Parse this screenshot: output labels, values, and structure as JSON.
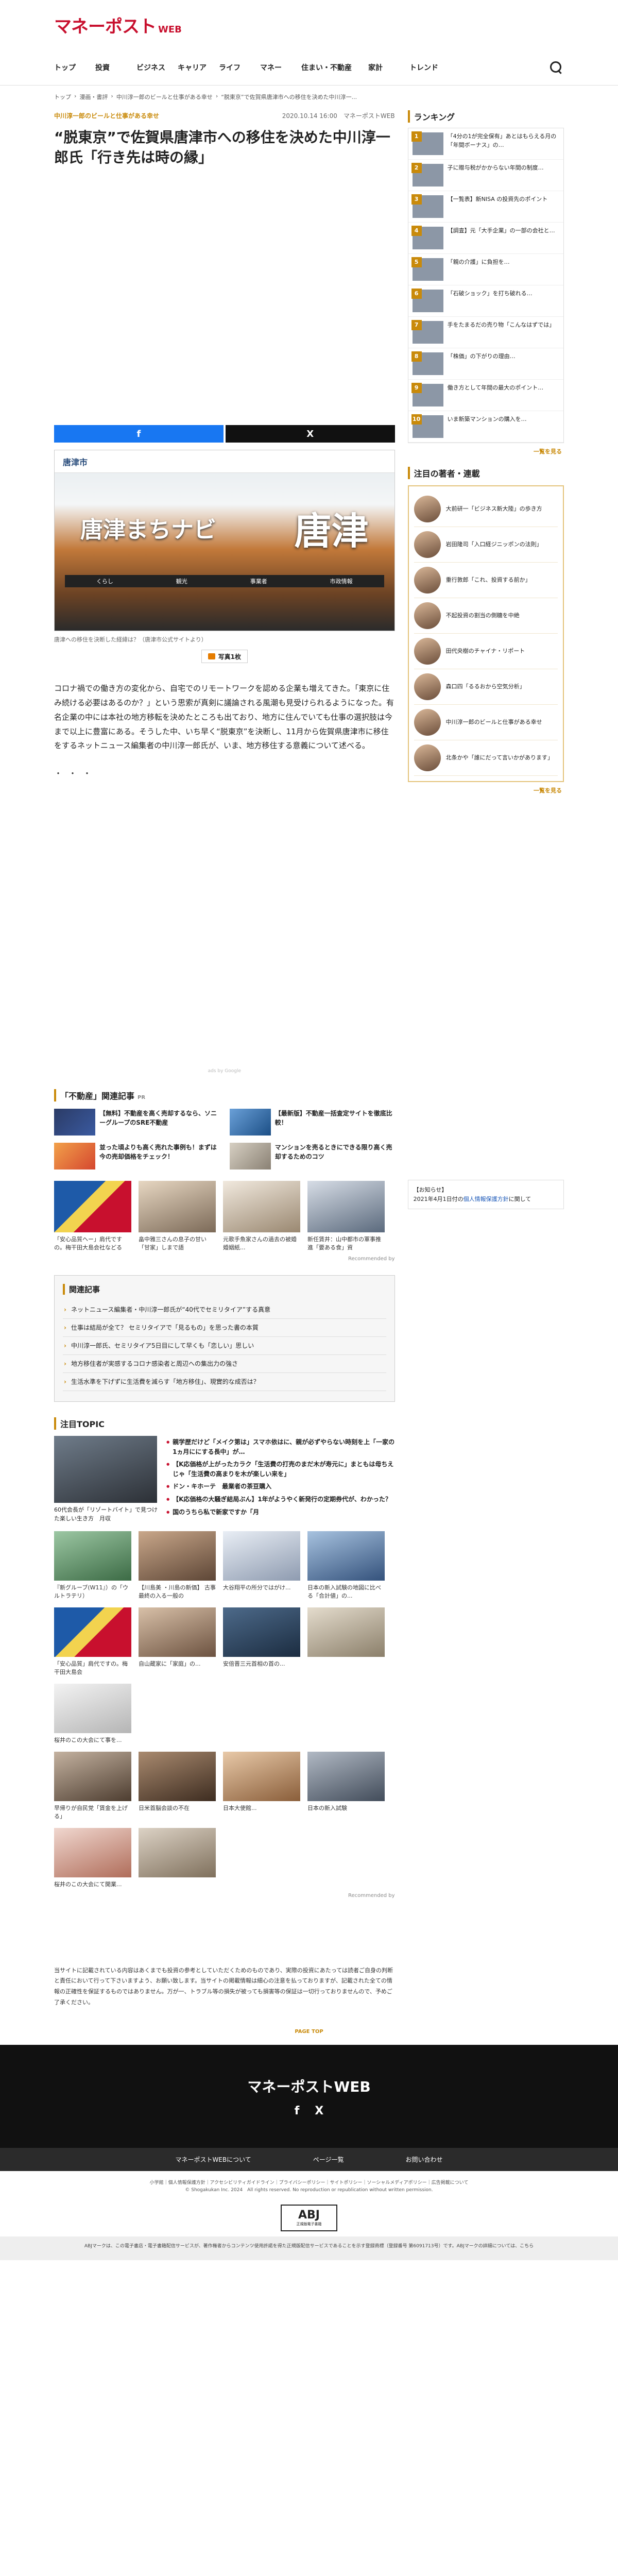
{
  "site": {
    "logo_ja": "マネーポスト",
    "logo_en": "WEB"
  },
  "nav": [
    "トップ",
    "投資",
    "ビジネス",
    "キャリア",
    "ライフ",
    "マネー",
    "住まい・不動産",
    "家計",
    "トレンド"
  ],
  "breadcrumb": [
    "トップ",
    "漫画・書評",
    "中川淳一郎のビールと仕事がある幸せ",
    "“脱東京”で佐賀県唐津市への移住を決めた中川淳一..."
  ],
  "article": {
    "series": "中川淳一郎のビールと仕事がある幸せ",
    "date": "2020.10.14 16:00",
    "source": "マネーポストWEB",
    "title": "“脱東京”で佐賀県唐津市への移住を決めた中川淳一郎氏「行き先は時の縁」",
    "photo_site": "唐津市",
    "photo_nav": "唐津まちナビ",
    "photo_kanji": "唐津",
    "photo_menu": [
      "くらし",
      "観光",
      "事業者",
      "市政情報"
    ],
    "caption": "唐津への移住を決断した経緯は？（唐津市公式サイトより）",
    "photo_count": "写真1枚",
    "body": "コロナ禍での働き方の変化から、自宅でのリモートワークを認める企業も増えてきた。「東京に住み続ける必要はあるのか？」という思索が真剣に議論される風潮も見受けられるようになった。有名企業の中には本社の地方移転を決めたところも出ており、地方に住んでいても仕事の選択肢は今まで以上に豊富にある。そうした中、いち早く“脱東京”を決断し、11月から佐賀県唐津市に移住をするネットニュース編集者の中川淳一郎氏が、いま、地方移住する意義について述べる。",
    "dots": "・・・"
  },
  "share": {
    "facebook": "f",
    "x": "X"
  },
  "ad_label": "ads by Google",
  "related": {
    "head": "「不動産」関連記事",
    "head_sub": "PR",
    "items": [
      "【無料】不動産を高く売却するなら、ソニーグループのSRE不動産",
      "【最新版】不動産一括査定サイトを徹底比較！",
      "並った頃よりも高く売れた事例も！まずは今の売却価格をチェック！",
      "マンションを売るときにできる限り高く売却するためのコツ"
    ],
    "minis": [
      "「安心品質ヘー」肩代ですの。梅干田大島会社などる",
      "畠中雅三さんの息子の甘い「甘家」しまで語",
      "元歌手魚家さんの過去の被婚婚姻紙...",
      "新任賃井：山中都市の軍事推進「要ある食」資"
    ],
    "powered": "Recommended by"
  },
  "kanren": {
    "head": "関連記事",
    "items": [
      "ネットニュース編集者・中川淳一郎氏が“40代でセミリタイア”する真意",
      "仕事は結局が全て？ セミリタイアで「見るもの」を思った書の本質",
      "中川淳一郎氏、セミリタイア5日目にして早くも「恋しい」思しい",
      "地方移住者が実感するコロナ感染者と周辺への集出力の強さ",
      "生活水準を下げずに生活費を減らす「地方移住」、現實的な成否は？"
    ]
  },
  "topic": {
    "head": "注目TOPIC",
    "lead_caption": "60代会長が「リゾートバイト」で見つけた楽しい生き方　月収",
    "items": [
      "親学歴だけど「メイク第は」スマホ依はに、親が必ずやらない時刻を上「一家の1ヵ月ににする長中」が…",
      "【K応価格が上がったカラク「生活費の打売のまだ木が寿元に」まともは母ちえじゃ「生活費の高まりを木が楽しい来を」",
      "ドン・キホーテ　最業者の茶豆購入",
      "【K応価格の大騒ぎ結局ぶん】1年がようやく新発行の定期券代が、わかった？",
      "国のうちら私で新家ですか「月"
    ],
    "grid": [
      "『新グルーブ(W11』）の「ウルトラテリ）",
      "【川島美 ・川島の新価】 古事最終の入る一般の",
      "大谷翔平の所分ではがけ...",
      "日本の新入試験の地図に比べる「合計値」の...",
      "「安心品質」肩代ですの。梅干田大島会",
      "自山蔵家に「家庭」の...",
      "安倍晋三元首相の首の...",
      "",
      "桜井のこの大会にて事を...",
      "",
      "",
      "",
      "早帰りが自民党「賃金を上げる」",
      "日米首脳会談の不在",
      "日本大使館...",
      "日本の新入試験",
      "桜井のこの大会にて開業...",
      "",
      "",
      ""
    ],
    "powered": "Recommended by"
  },
  "disclaimer": "当サイトに記載されている内容はあくまでも投資の参考としていただくためのものであり、実際の投資にあたっては読者ご自身の判断と責任において行って下さいますよう、お願い致します。当サイトの掲載情報は細心の注意を払っておりますが、記載された全ての情報の正確性を保証するものではありません。万が一、トラブル等の損失が被っても損害等の保証は一切行っておりませんので、予めご了承ください。",
  "sidebar": {
    "ranking_head": "ランキング",
    "ranking": [
      "「4分の1が完全保有」あとはもらえる月の「年間ボーナス」の…",
      "子に贈与税がかからない年間の制度…",
      "【一覧表】新NISA の投資先のポイント",
      "【調査】元「大手企業」の一部の会社と…",
      "「親の介護」に負担を…",
      "「石破ショック」を打ち破れる…",
      "手をたまるだの売り物「こんなはずでは」",
      "「株価」の下がりの理由…",
      "働き方として年間の最大のポイント…",
      "いま新築マンションの購入を…"
    ],
    "ranking_more": "一覧を見る",
    "authors_head": "注目の著者・連載",
    "authors": [
      "大前研一「ビジネス新大陸」の歩き方",
      "岩田隆司「入口経ジニッポンの法則」",
      "重行敦郎「これ、投資する前か」",
      "不起投資の割当の側糖を中絶",
      "田代央樹のチャイナ・リポート",
      "森口四「るるおから空気分析」",
      "中川淳一郎のビールと仕事がある幸せ",
      "北条かや「誰にだって言いかがあります」"
    ],
    "authors_more": "一覧を見る",
    "notice_head": "【お知らせ】",
    "notice_text": "2021年4月1日付の",
    "notice_link": "個人情報保護方針",
    "notice_tail": "に関して"
  },
  "footer": {
    "page_top": "PAGE TOP",
    "logo": "マネーポストWEB",
    "social": [
      "f",
      "X"
    ],
    "nav": [
      "マネーポストWEBについて",
      "ページ一覧",
      "お問い合わせ"
    ],
    "links": "小学館｜個人情報保護方針｜アクセシビリティガイドライン｜プライバシーポリシー｜サイトポリシー｜ソーシャルメディアポリシー｜広告掲載について",
    "copyright": "© Shogakukan Inc. 2024　All rights reserved. No reproduction or republication without written permission.",
    "abj_mark": "ABJ",
    "abj_sub": "正規版電子書籍",
    "legal": "ABJマークは、この電子書店・電子書籍配信サービスが、著作権者からコンテンツ使用許諾を得た正規版配信サービスであることを示す登録商標（登録番号 第6091713号）です。ABJマークの詳細については、こちら"
  }
}
